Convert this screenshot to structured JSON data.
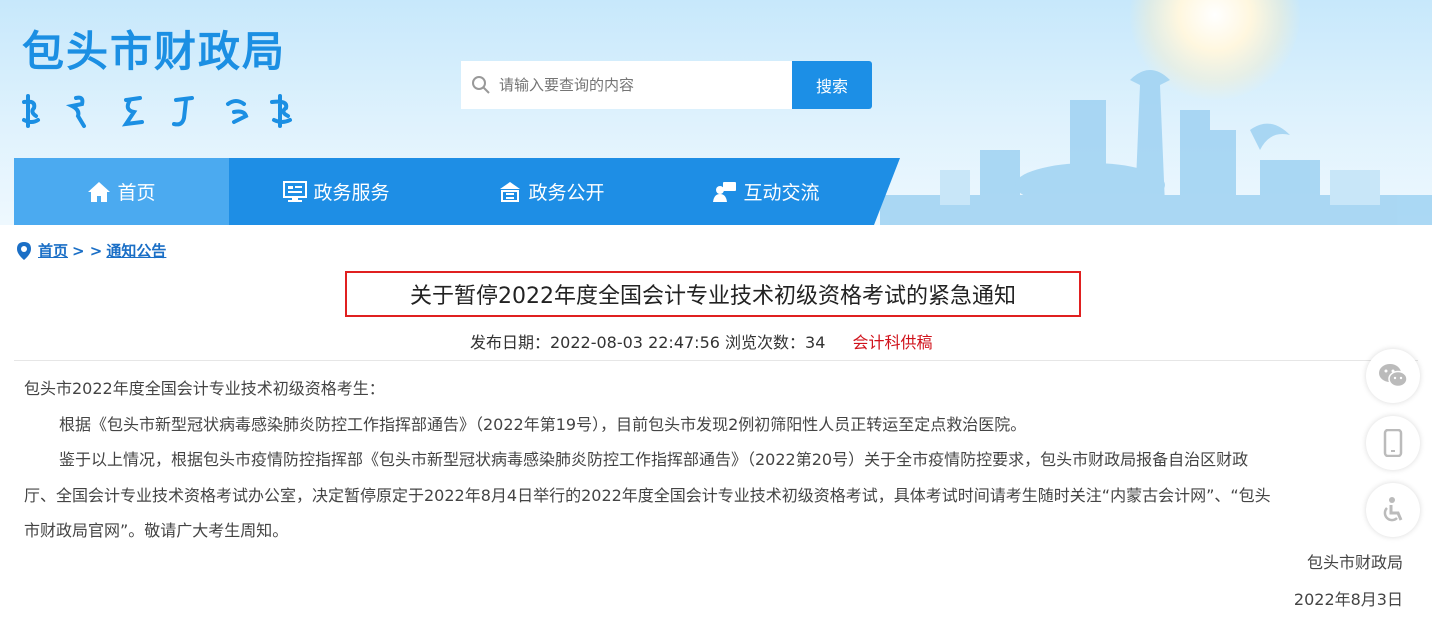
{
  "header": {
    "site_title": "包头市财政局",
    "search": {
      "placeholder": "请输入要查询的内容",
      "button_label": "搜索"
    }
  },
  "nav": {
    "items": [
      {
        "label": "首页",
        "icon": "home-icon",
        "active": true
      },
      {
        "label": "政务服务",
        "icon": "monitor-icon"
      },
      {
        "label": "政务公开",
        "icon": "building-icon"
      },
      {
        "label": "互动交流",
        "icon": "people-chat-icon"
      }
    ]
  },
  "breadcrumb": {
    "home": "首页",
    "separator": "> >",
    "current": "通知公告"
  },
  "article": {
    "title": "关于暂停2022年度全国会计专业技术初级资格考试的紧急通知",
    "meta": {
      "date_label": "发布日期：2022-08-03 22:47:56",
      "views_label": "浏览次数：34",
      "source": "会计科供稿"
    },
    "salutation": "包头市2022年度全国会计专业技术初级资格考生：",
    "paragraph1": "根据《包头市新型冠状病毒感染肺炎防控工作指挥部通告》（2022年第19号），目前包头市发现2例初筛阳性人员正转运至定点救治医院。",
    "paragraph2_line1": "鉴于以上情况，根据包头市疫情防控指挥部《包头市新型冠状病毒感染肺炎防控工作指挥部通告》（2022第20号）关于全市疫情防控要求，包头市财政局报备自治区财政",
    "paragraph2_line2": "厅、全国会计专业技术资格考试办公室，决定暂停原定于2022年8月4日举行的2022年度全国会计专业技术初级资格考试，具体考试时间请考生随时关注“内蒙古会计网”、“包头",
    "paragraph2_line3": "市财政局官网”。敬请广大考生周知。",
    "signature": "包头市财政局",
    "sign_date": "2022年8月3日"
  },
  "side_tools": [
    {
      "icon": "wechat-icon"
    },
    {
      "icon": "mobile-icon"
    },
    {
      "icon": "accessibility-icon"
    }
  ],
  "colors": {
    "brand_blue": "#1e8ee5",
    "active_nav": "#4baaf0",
    "title_border": "#e02020",
    "source_red": "#d0121b"
  }
}
